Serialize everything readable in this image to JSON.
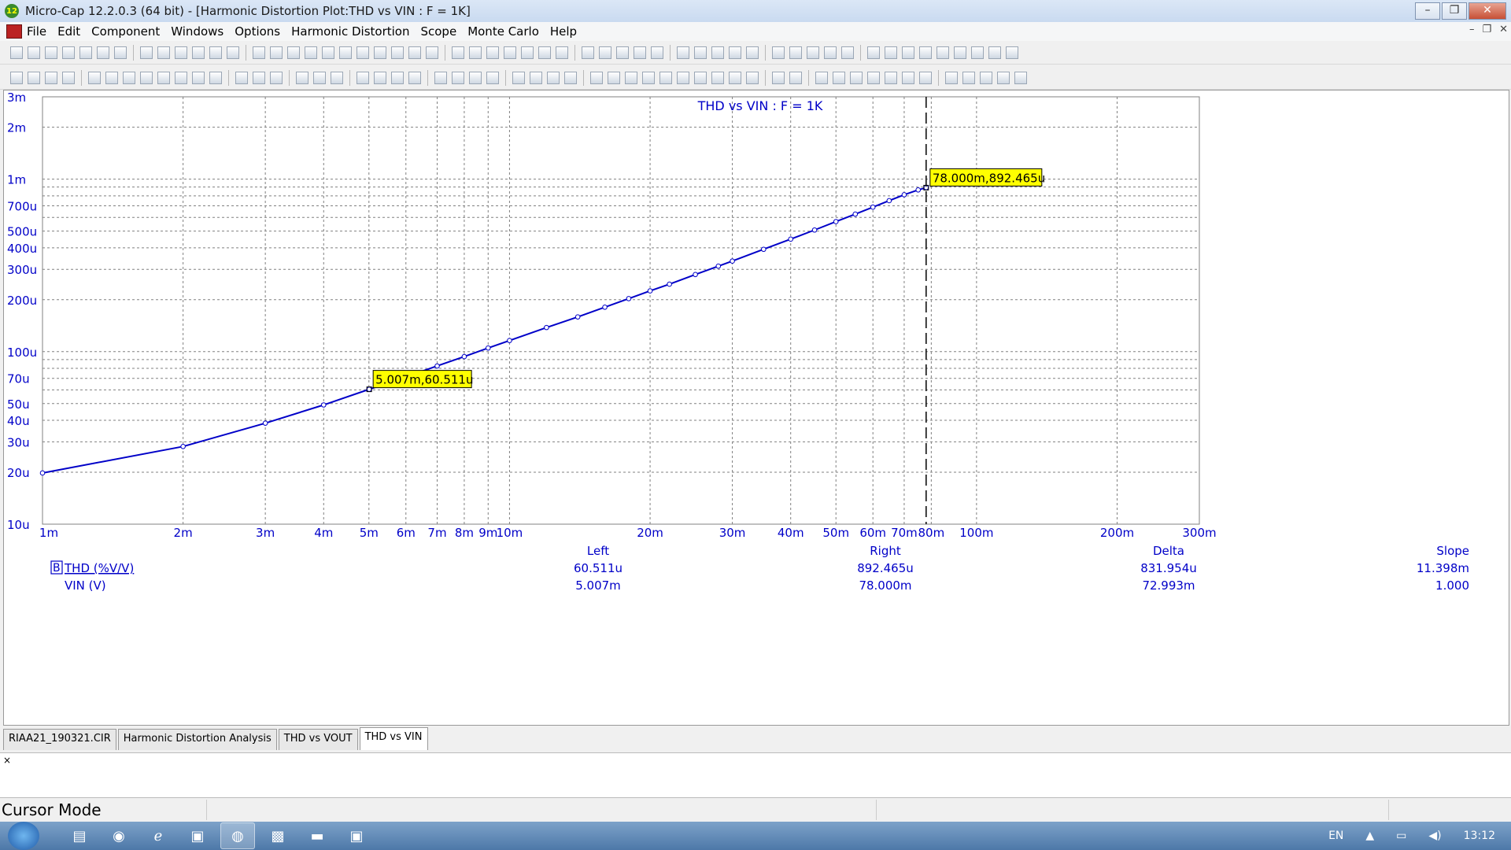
{
  "window": {
    "title": "Micro-Cap 12.2.0.3 (64 bit) - [Harmonic Distortion Plot:THD vs VIN : F = 1K]",
    "app_icon_text": "12"
  },
  "menu": [
    "File",
    "Edit",
    "Component",
    "Windows",
    "Options",
    "Harmonic Distortion",
    "Scope",
    "Monte Carlo",
    "Help"
  ],
  "tabs": [
    "RIAA21_190321.CIR",
    "Harmonic Distortion Analysis",
    "THD vs VOUT",
    "THD vs VIN"
  ],
  "active_tab": "THD vs VIN",
  "status": {
    "mode": "Cursor Mode"
  },
  "tray": {
    "lang": "EN",
    "time": "13:12"
  },
  "colors": {
    "plot_line": "#0000c8",
    "text_blue": "#0000c8",
    "cursor_label_bg": "#ffff00",
    "grid": "#808080"
  },
  "chart_data": {
    "type": "line",
    "title": "THD vs VIN : F = 1K",
    "x_scale": "log",
    "y_scale": "log",
    "xlim": [
      0.001,
      0.3
    ],
    "ylim": [
      1e-05,
      0.003
    ],
    "x_tick_labels": [
      "1m",
      "2m",
      "3m",
      "4m",
      "5m",
      "6m",
      "7m",
      "8m",
      "9m",
      "10m",
      "20m",
      "30m",
      "40m",
      "50m",
      "60m",
      "70m",
      "80m",
      "100m",
      "200m",
      "300m"
    ],
    "y_tick_labels": [
      "3m",
      "2m",
      "1m",
      "700u",
      "500u",
      "400u",
      "300u",
      "200u",
      "100u",
      "70u",
      "50u",
      "40u",
      "30u",
      "20u",
      "10u"
    ],
    "series": [
      {
        "name": "THD (%V/V)",
        "marker": "circle",
        "x": [
          0.001,
          0.002,
          0.003,
          0.004,
          0.005007,
          0.006,
          0.007,
          0.008,
          0.009,
          0.01,
          0.012,
          0.014,
          0.016,
          0.018,
          0.02,
          0.022,
          0.025,
          0.028,
          0.03,
          0.035,
          0.04,
          0.045,
          0.05,
          0.055,
          0.06,
          0.065,
          0.07,
          0.075,
          0.078
        ],
        "y": [
          1.98e-05,
          2.82e-05,
          3.85e-05,
          4.91e-05,
          6.0511e-05,
          7.13e-05,
          8.26e-05,
          9.36e-05,
          0.000105,
          0.000116,
          0.000138,
          0.000159,
          0.000181,
          0.000203,
          0.000225,
          0.000246,
          0.00028,
          0.000313,
          0.000335,
          0.000392,
          0.000449,
          0.000507,
          0.000567,
          0.000627,
          0.000688,
          0.00075,
          0.000812,
          0.000866,
          0.000892465
        ]
      }
    ],
    "legend": {
      "trace_label": "THD (%V/V)",
      "trace_marker": "B",
      "xvar_label": "VIN (V)"
    },
    "cursor_labels": [
      {
        "text": "5.007m,60.511u",
        "x": 0.005007,
        "y": 6.0511e-05
      },
      {
        "text": "78.000m,892.465u",
        "x": 0.078,
        "y": 0.000892465
      }
    ],
    "cursor_x": 0.078,
    "readout": {
      "headers": [
        "Left",
        "Right",
        "Delta",
        "Slope"
      ],
      "thd": [
        "60.511u",
        "892.465u",
        "831.954u",
        "11.398m"
      ],
      "vin": [
        "5.007m",
        "78.000m",
        "72.993m",
        "1.000"
      ]
    }
  }
}
